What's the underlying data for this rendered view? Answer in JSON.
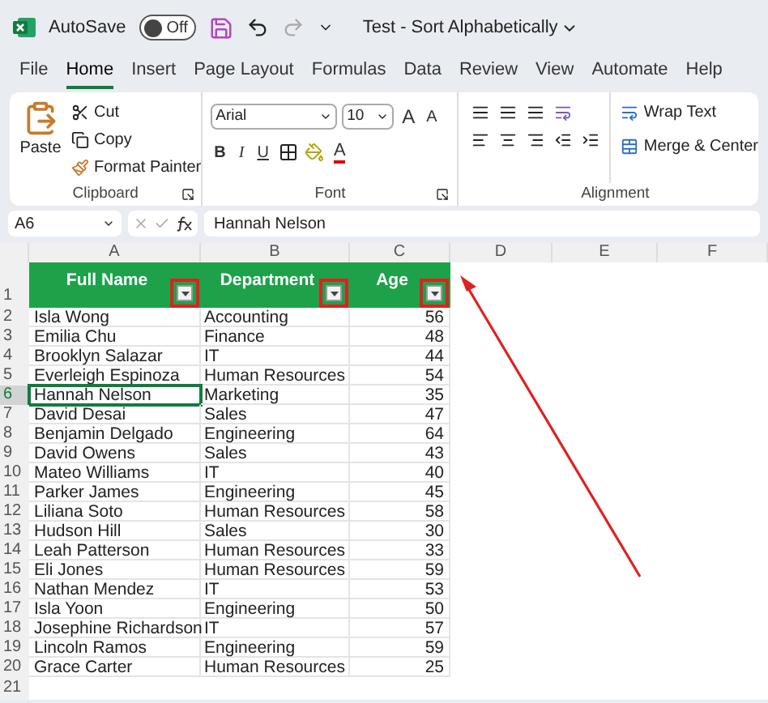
{
  "title_bar": {
    "autosave_label": "AutoSave",
    "autosave": {
      "on": false,
      "label": "Off"
    },
    "document_title": "Test - Sort Alphabetically"
  },
  "menu_tabs": [
    {
      "label": "File",
      "selected": false
    },
    {
      "label": "Home",
      "selected": true
    },
    {
      "label": "Insert",
      "selected": false
    },
    {
      "label": "Page Layout",
      "selected": false
    },
    {
      "label": "Formulas",
      "selected": false
    },
    {
      "label": "Data",
      "selected": false
    },
    {
      "label": "Review",
      "selected": false
    },
    {
      "label": "View",
      "selected": false
    },
    {
      "label": "Automate",
      "selected": false
    },
    {
      "label": "Help",
      "selected": false
    }
  ],
  "ribbon": {
    "clipboard": {
      "paste": "Paste",
      "cut": "Cut",
      "copy": "Copy",
      "format_painter": "Format Painter",
      "group_label": "Clipboard"
    },
    "font": {
      "font_name": "Arial",
      "font_size": "10",
      "grow": "A",
      "shrink": "A",
      "bold": "B",
      "italic": "I",
      "underline": "U",
      "font_color": "A",
      "group_label": "Font"
    },
    "alignment": {
      "wrap_text": "Wrap Text",
      "merge_center": "Merge & Center",
      "group_label": "Alignment"
    }
  },
  "formula_bar": {
    "name_box": "A6",
    "value": "Hannah Nelson"
  },
  "columns": [
    "A",
    "B",
    "C",
    "D",
    "E",
    "F"
  ],
  "sheet": {
    "header_row": "1",
    "headers": [
      {
        "label": "Full Name",
        "highlighted": true
      },
      {
        "label": "Department",
        "highlighted": true
      },
      {
        "label": "Age",
        "highlighted": true
      }
    ],
    "rows": [
      {
        "row": "2",
        "name": "Isla Wong",
        "department": "Accounting",
        "age": "56",
        "selected": false
      },
      {
        "row": "3",
        "name": "Emilia Chu",
        "department": "Finance",
        "age": "48",
        "selected": false
      },
      {
        "row": "4",
        "name": "Brooklyn Salazar",
        "department": "IT",
        "age": "44",
        "selected": false
      },
      {
        "row": "5",
        "name": "Everleigh Espinoza",
        "department": "Human Resources",
        "age": "54",
        "selected": false
      },
      {
        "row": "6",
        "name": "Hannah Nelson",
        "department": "Marketing",
        "age": "35",
        "selected": true
      },
      {
        "row": "7",
        "name": "David Desai",
        "department": "Sales",
        "age": "47",
        "selected": false
      },
      {
        "row": "8",
        "name": "Benjamin Delgado",
        "department": "Engineering",
        "age": "64",
        "selected": false
      },
      {
        "row": "9",
        "name": "David Owens",
        "department": "Sales",
        "age": "43",
        "selected": false
      },
      {
        "row": "10",
        "name": "Mateo Williams",
        "department": "IT",
        "age": "40",
        "selected": false
      },
      {
        "row": "11",
        "name": "Parker James",
        "department": "Engineering",
        "age": "45",
        "selected": false
      },
      {
        "row": "12",
        "name": "Liliana Soto",
        "department": "Human Resources",
        "age": "58",
        "selected": false
      },
      {
        "row": "13",
        "name": "Hudson Hill",
        "department": "Sales",
        "age": "30",
        "selected": false
      },
      {
        "row": "14",
        "name": "Leah Patterson",
        "department": "Human Resources",
        "age": "33",
        "selected": false
      },
      {
        "row": "15",
        "name": "Eli Jones",
        "department": "Human Resources",
        "age": "59",
        "selected": false
      },
      {
        "row": "16",
        "name": "Nathan Mendez",
        "department": "IT",
        "age": "53",
        "selected": false
      },
      {
        "row": "17",
        "name": "Isla Yoon",
        "department": "Engineering",
        "age": "50",
        "selected": false
      },
      {
        "row": "18",
        "name": "Josephine Richardson",
        "department": "IT",
        "age": "57",
        "selected": false
      },
      {
        "row": "19",
        "name": "Lincoln Ramos",
        "department": "Engineering",
        "age": "59",
        "selected": false
      },
      {
        "row": "20",
        "name": "Grace Carter",
        "department": "Human Resources",
        "age": "25",
        "selected": false
      }
    ],
    "empty_rows": [
      "21"
    ]
  }
}
